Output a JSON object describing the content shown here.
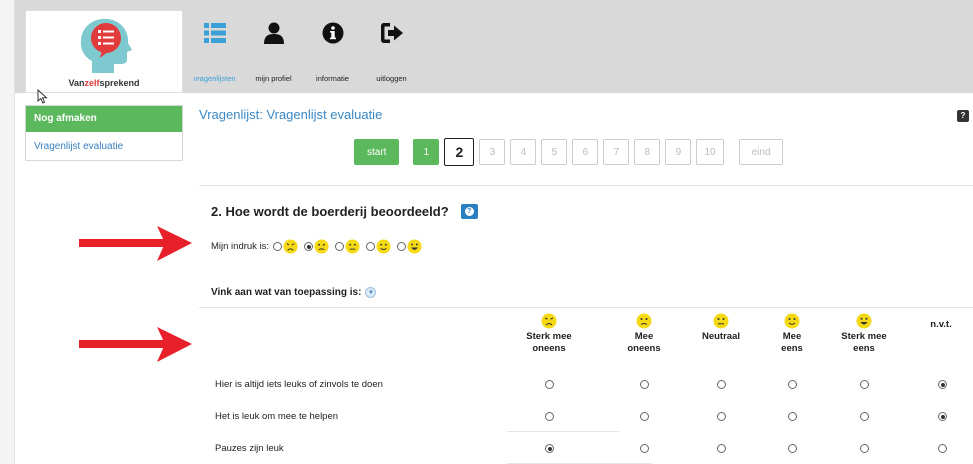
{
  "logo": {
    "brand_prefix": "Van",
    "brand_accent": "zelf",
    "brand_suffix": "sprekend"
  },
  "nav": [
    {
      "label": "vragenlijsten",
      "icon": "list-icon",
      "active": true
    },
    {
      "label": "mijn profiel",
      "icon": "user-icon",
      "active": false
    },
    {
      "label": "informatie",
      "icon": "info-icon",
      "active": false
    },
    {
      "label": "uitloggen",
      "icon": "logout-icon",
      "active": false
    }
  ],
  "sidebar": {
    "heading": "Nog afmaken",
    "items": [
      {
        "label": "Vragenlijst evaluatie"
      }
    ]
  },
  "page": {
    "title": "Vragenlijst: Vragenlijst evaluatie",
    "help": "?"
  },
  "pager": {
    "start": "start",
    "pages": [
      "1",
      "2",
      "3",
      "4",
      "5",
      "6",
      "7",
      "8",
      "9",
      "10"
    ],
    "current": "2",
    "end": "eind"
  },
  "question": {
    "text": "2. Hoe wordt de boerderij beoordeeld?",
    "help": "?"
  },
  "impression": {
    "label": "Mijn indruk is:",
    "options": [
      "very-sad-smiley",
      "sad-smiley",
      "neutral-smiley",
      "smile-smiley",
      "happy-smiley"
    ],
    "selected_index": 1
  },
  "checklist": {
    "label": "Vink aan wat van toepassing is:",
    "columns": [
      {
        "line1": "Sterk mee",
        "line2": "oneens",
        "icon": "very-sad-smiley"
      },
      {
        "line1": "Mee",
        "line2": "oneens",
        "icon": "sad-smiley"
      },
      {
        "line1": "Neutraal",
        "line2": "",
        "icon": "neutral-smiley"
      },
      {
        "line1": "Mee",
        "line2": "eens",
        "icon": "smile-smiley"
      },
      {
        "line1": "Sterk mee",
        "line2": "eens",
        "icon": "happy-smiley"
      },
      {
        "line1": "n.v.t.",
        "line2": "",
        "icon": ""
      }
    ],
    "rows": [
      {
        "label": "Hier is altijd iets leuks of zinvols te doen",
        "selected": 5
      },
      {
        "label": "Het is leuk om mee te helpen",
        "selected": 5
      },
      {
        "label": "Pauzes zijn leuk",
        "selected": 0
      }
    ]
  },
  "colors": {
    "accent_blue": "#3a88c6",
    "green": "#5cb85c",
    "arrow_red": "#e8202a",
    "smiley_yellow": "#f5d914",
    "logo_red": "#e23b3b",
    "logo_head": "#7ec9cf"
  }
}
